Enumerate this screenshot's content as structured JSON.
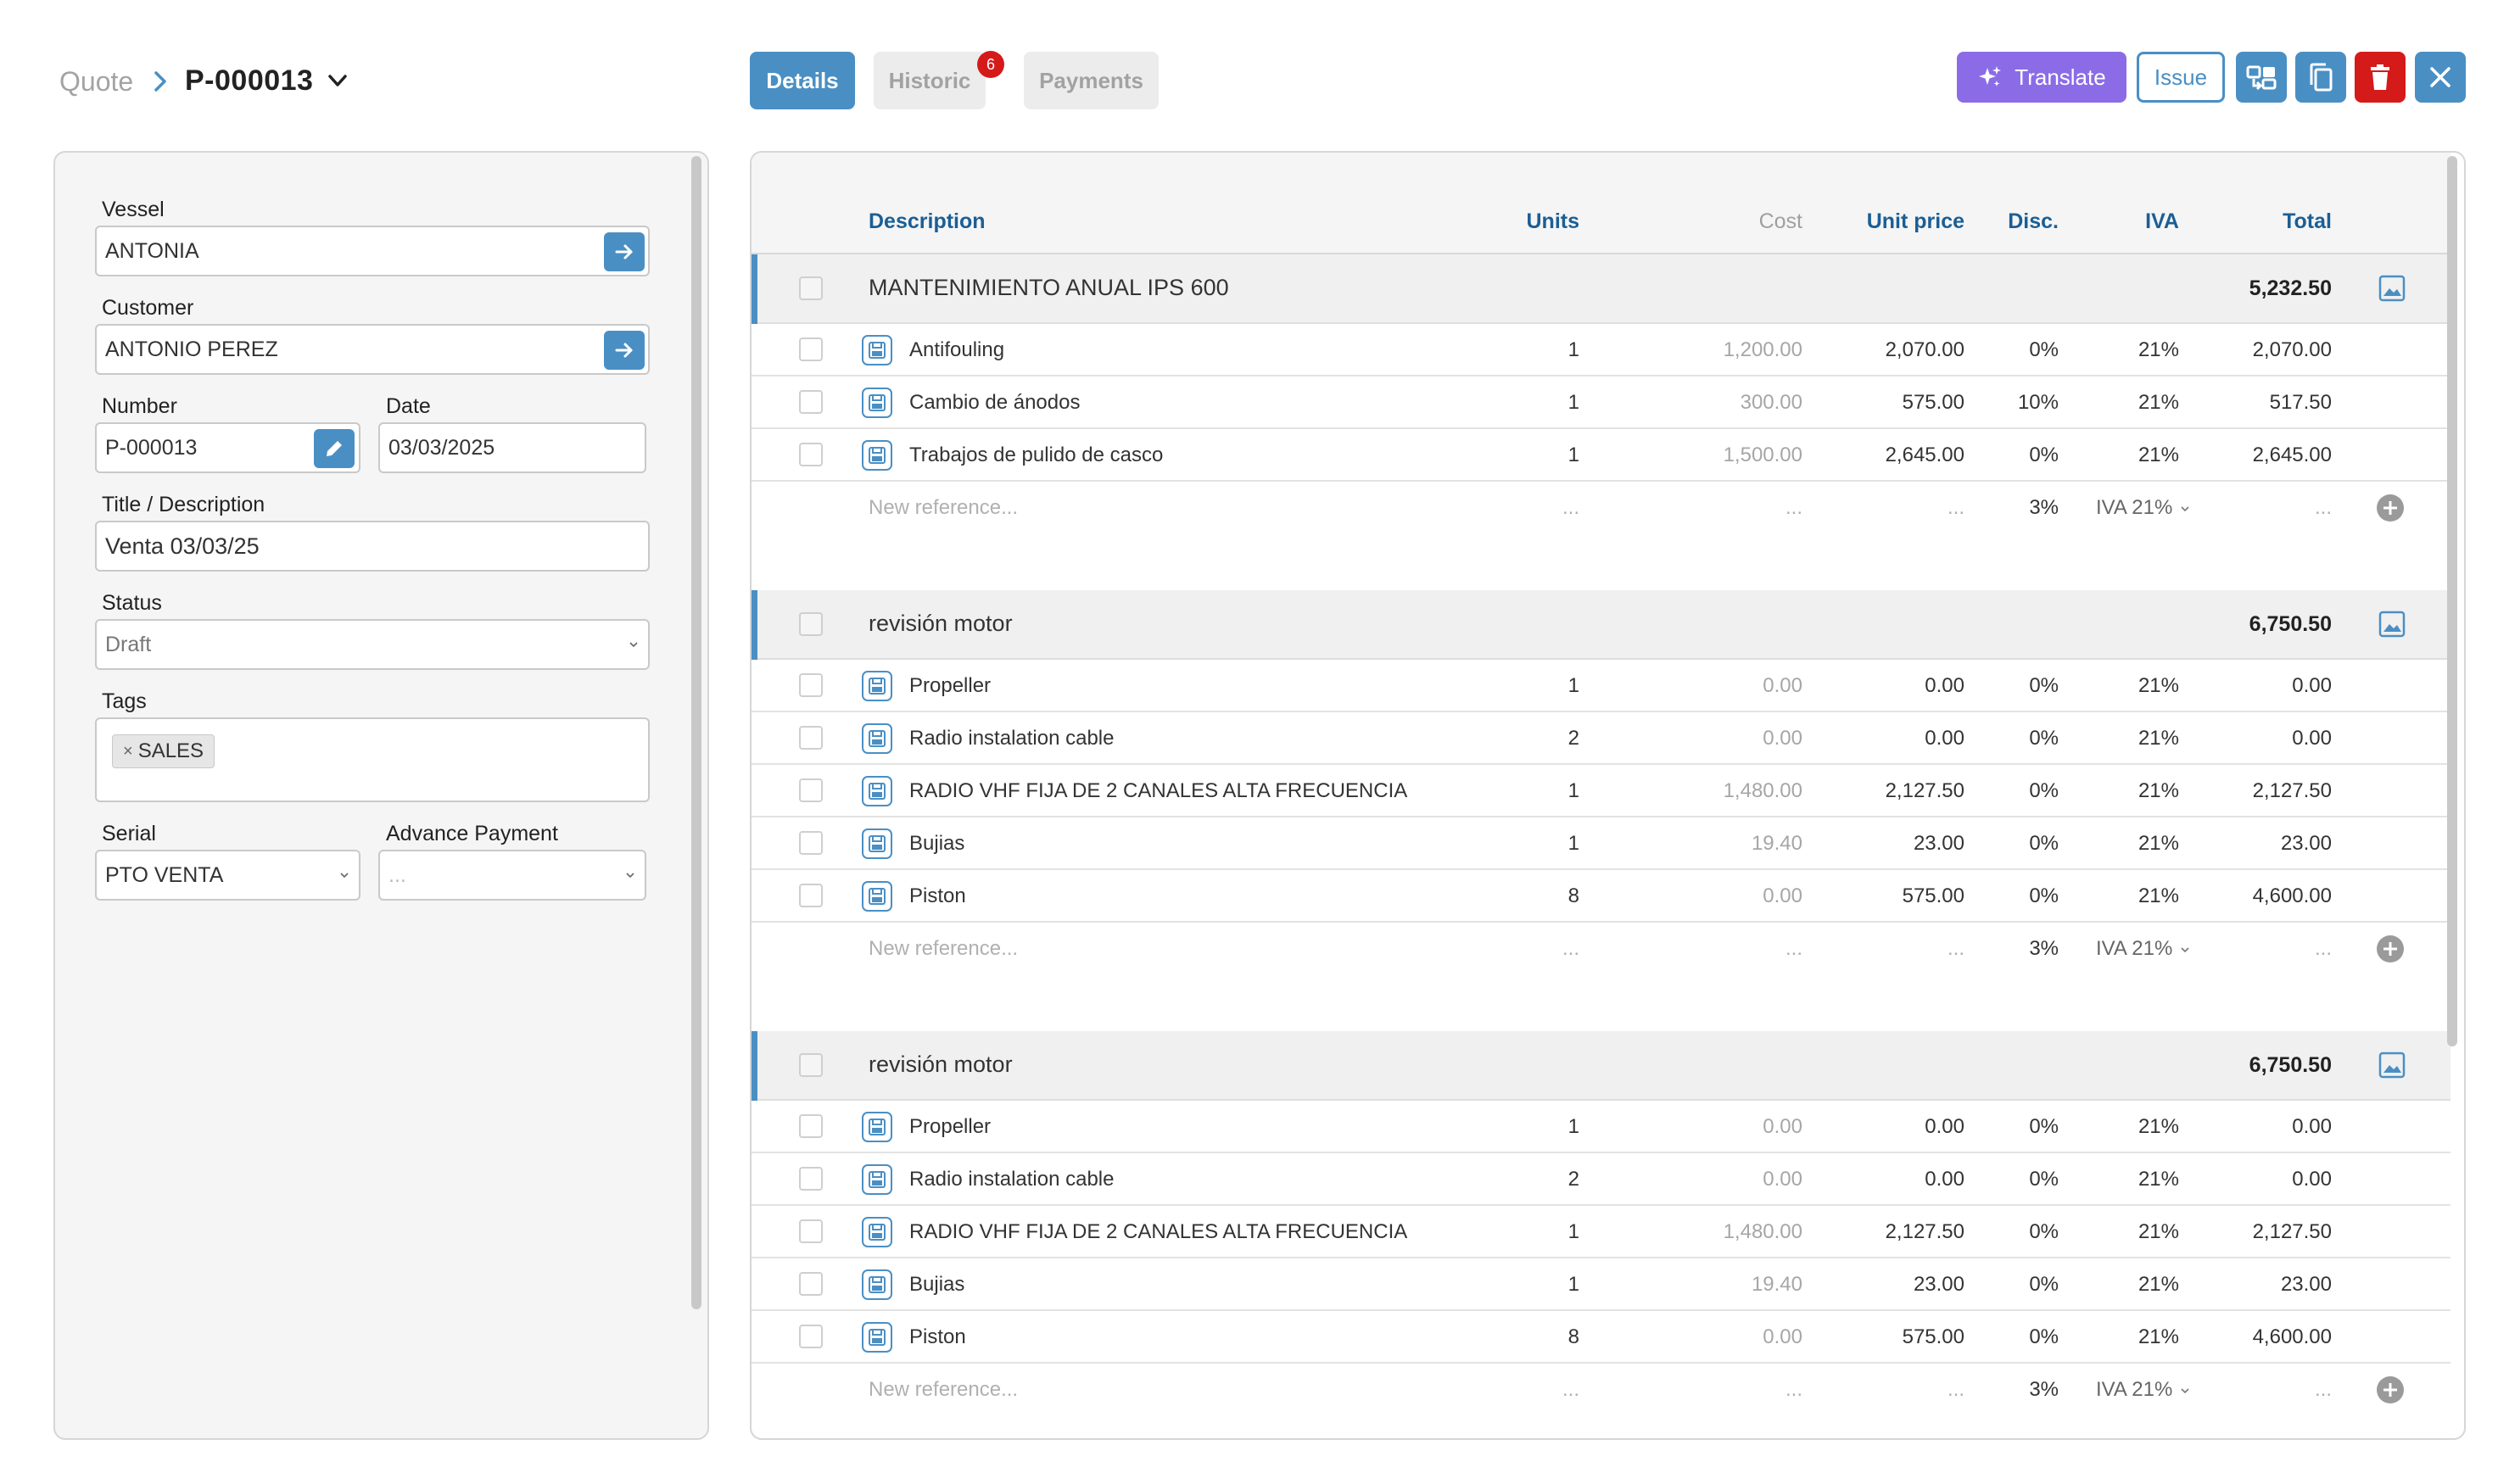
{
  "breadcrumb": {
    "root": "Quote",
    "current": "P-000013"
  },
  "tabs": [
    {
      "label": "Details"
    },
    {
      "label": "Historic",
      "badge": "6"
    },
    {
      "label": "Payments"
    }
  ],
  "actions": {
    "translate_label": "Translate",
    "issue_label": "Issue",
    "icons": [
      "convert-icon",
      "copy-icon",
      "trash-icon",
      "close-icon"
    ]
  },
  "colors": {
    "primary": "#4a8fc4",
    "translate": "#8b6ce6",
    "danger": "#d51a1a",
    "header_text": "#1b5e95"
  },
  "form": {
    "vessel_label": "Vessel",
    "vessel_value": "ANTONIA",
    "customer_label": "Customer",
    "customer_value": "ANTONIO PEREZ",
    "number_label": "Number",
    "number_value": "P-000013",
    "date_label": "Date",
    "date_value": "03/03/2025",
    "title_label": "Title / Description",
    "title_value": "Venta 03/03/25",
    "status_label": "Status",
    "status_value": "Draft",
    "tags_label": "Tags",
    "tags": [
      "SALES"
    ],
    "serial_label": "Serial",
    "serial_value": "PTO VENTA",
    "advance_label": "Advance Payment",
    "advance_value": "..."
  },
  "table": {
    "headers": {
      "description": "Description",
      "units": "Units",
      "cost": "Cost",
      "unit_price": "Unit price",
      "disc": "Disc.",
      "iva": "IVA",
      "total": "Total"
    },
    "new_row": {
      "placeholder": "New reference...",
      "ellipsis": "...",
      "disc": "3%",
      "iva": "IVA 21%"
    },
    "groups": [
      {
        "title": "MANTENIMIENTO ANUAL IPS 600",
        "total": "5,232.50",
        "lines": [
          {
            "description": "Antifouling",
            "units": "1",
            "cost": "1,200.00",
            "unit_price": "2,070.00",
            "disc": "0%",
            "iva": "21%",
            "total": "2,070.00"
          },
          {
            "description": "Cambio de ánodos",
            "units": "1",
            "cost": "300.00",
            "unit_price": "575.00",
            "disc": "10%",
            "iva": "21%",
            "total": "517.50"
          },
          {
            "description": "Trabajos de pulido de casco",
            "units": "1",
            "cost": "1,500.00",
            "unit_price": "2,645.00",
            "disc": "0%",
            "iva": "21%",
            "total": "2,645.00"
          }
        ]
      },
      {
        "title": "revisión motor",
        "total": "6,750.50",
        "lines": [
          {
            "description": "Propeller",
            "units": "1",
            "cost": "0.00",
            "unit_price": "0.00",
            "disc": "0%",
            "iva": "21%",
            "total": "0.00"
          },
          {
            "description": "Radio instalation cable",
            "units": "2",
            "cost": "0.00",
            "unit_price": "0.00",
            "disc": "0%",
            "iva": "21%",
            "total": "0.00"
          },
          {
            "description": "RADIO VHF FIJA DE 2 CANALES ALTA FRECUENCIA",
            "units": "1",
            "cost": "1,480.00",
            "unit_price": "2,127.50",
            "disc": "0%",
            "iva": "21%",
            "total": "2,127.50"
          },
          {
            "description": "Bujias",
            "units": "1",
            "cost": "19.40",
            "unit_price": "23.00",
            "disc": "0%",
            "iva": "21%",
            "total": "23.00"
          },
          {
            "description": "Piston",
            "units": "8",
            "cost": "0.00",
            "unit_price": "575.00",
            "disc": "0%",
            "iva": "21%",
            "total": "4,600.00"
          }
        ]
      },
      {
        "title": "revisión motor",
        "total": "6,750.50",
        "lines": [
          {
            "description": "Propeller",
            "units": "1",
            "cost": "0.00",
            "unit_price": "0.00",
            "disc": "0%",
            "iva": "21%",
            "total": "0.00"
          },
          {
            "description": "Radio instalation cable",
            "units": "2",
            "cost": "0.00",
            "unit_price": "0.00",
            "disc": "0%",
            "iva": "21%",
            "total": "0.00"
          },
          {
            "description": "RADIO VHF FIJA DE 2 CANALES ALTA FRECUENCIA",
            "units": "1",
            "cost": "1,480.00",
            "unit_price": "2,127.50",
            "disc": "0%",
            "iva": "21%",
            "total": "2,127.50"
          },
          {
            "description": "Bujias",
            "units": "1",
            "cost": "19.40",
            "unit_price": "23.00",
            "disc": "0%",
            "iva": "21%",
            "total": "23.00"
          },
          {
            "description": "Piston",
            "units": "8",
            "cost": "0.00",
            "unit_price": "575.00",
            "disc": "0%",
            "iva": "21%",
            "total": "4,600.00"
          }
        ]
      }
    ]
  }
}
